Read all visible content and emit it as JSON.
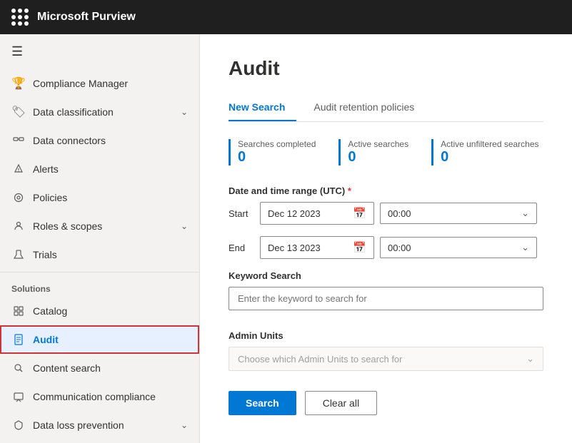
{
  "topbar": {
    "title": "Microsoft Purview"
  },
  "sidebar": {
    "hamburger_icon": "☰",
    "items": [
      {
        "id": "compliance-manager",
        "label": "Compliance Manager",
        "icon": "🏆",
        "has_chevron": false
      },
      {
        "id": "data-classification",
        "label": "Data classification",
        "icon": "🏷",
        "has_chevron": true
      },
      {
        "id": "data-connectors",
        "label": "Data connectors",
        "icon": "🔌",
        "has_chevron": false
      },
      {
        "id": "alerts",
        "label": "Alerts",
        "icon": "🔔",
        "has_chevron": false
      },
      {
        "id": "policies",
        "label": "Policies",
        "icon": "⚙",
        "has_chevron": false
      },
      {
        "id": "roles-scopes",
        "label": "Roles & scopes",
        "icon": "👤",
        "has_chevron": true
      },
      {
        "id": "trials",
        "label": "Trials",
        "icon": "🧪",
        "has_chevron": false
      }
    ],
    "solutions_label": "Solutions",
    "solution_items": [
      {
        "id": "catalog",
        "label": "Catalog",
        "icon": "📋",
        "has_chevron": false
      },
      {
        "id": "audit",
        "label": "Audit",
        "icon": "📄",
        "has_chevron": false,
        "active": true
      },
      {
        "id": "content-search",
        "label": "Content search",
        "icon": "🔍",
        "has_chevron": false
      },
      {
        "id": "communication-compliance",
        "label": "Communication compliance",
        "icon": "💬",
        "has_chevron": false
      },
      {
        "id": "data-loss-prevention",
        "label": "Data loss prevention",
        "icon": "🛡",
        "has_chevron": true
      }
    ]
  },
  "content": {
    "page_title": "Audit",
    "tabs": [
      {
        "id": "new-search",
        "label": "New Search",
        "active": true
      },
      {
        "id": "audit-retention",
        "label": "Audit retention policies",
        "active": false
      }
    ],
    "stats": [
      {
        "id": "searches-completed",
        "label": "Searches completed",
        "value": "0"
      },
      {
        "id": "active-searches",
        "label": "Active searches",
        "value": "0"
      },
      {
        "id": "active-unfiltered",
        "label": "Active unfiltered searches",
        "value": "0"
      }
    ],
    "date_time_section": {
      "label": "Date and time range (UTC)",
      "required": true,
      "start_label": "Start",
      "start_date": "Dec 12 2023",
      "start_time": "00:00",
      "end_label": "End",
      "end_date": "Dec 13 2023",
      "end_time": "00:00"
    },
    "keyword_search": {
      "label": "Keyword Search",
      "placeholder": "Enter the keyword to search for"
    },
    "admin_units": {
      "label": "Admin Units",
      "placeholder": "Choose which Admin Units to search for"
    },
    "buttons": {
      "search": "Search",
      "clear_all": "Clear all"
    }
  }
}
